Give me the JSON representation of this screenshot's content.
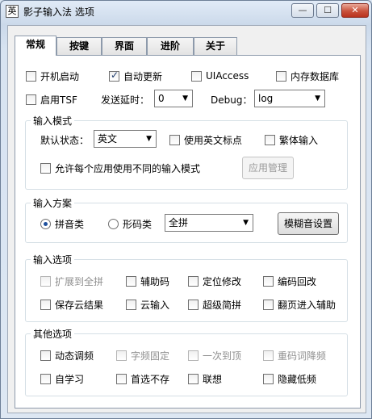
{
  "window": {
    "app_icon_char": "英",
    "title": "影子输入法 选项",
    "min_glyph": "—",
    "max_glyph": "☐",
    "close_glyph": "✕"
  },
  "tabs": [
    {
      "label": "常规"
    },
    {
      "label": "按键"
    },
    {
      "label": "界面"
    },
    {
      "label": "进阶"
    },
    {
      "label": "关于"
    }
  ],
  "general": {
    "autostart": {
      "label": "开机启动",
      "checked": false
    },
    "autoupdate": {
      "label": "自动更新",
      "checked": true
    },
    "uiaccess": {
      "label": "UIAccess",
      "checked": false
    },
    "memdb": {
      "label": "内存数据库",
      "checked": false
    },
    "tsf": {
      "label": "启用TSF",
      "checked": false
    },
    "delay_label": "发送延时：",
    "delay_value": "0",
    "debug_label": "Debug：",
    "debug_value": "log"
  },
  "input_mode": {
    "title": "输入模式",
    "default_state_label": "默认状态：",
    "default_state_value": "英文",
    "english_punct": {
      "label": "使用英文标点",
      "checked": false
    },
    "traditional": {
      "label": "繁体输入",
      "checked": false
    },
    "per_app": {
      "label": "允许每个应用使用不同的输入模式",
      "checked": false
    },
    "app_manage_button": "应用管理"
  },
  "input_scheme": {
    "title": "输入方案",
    "pinyin": {
      "label": "拼音类",
      "checked": true
    },
    "shape": {
      "label": "形码类",
      "checked": false
    },
    "scheme_value": "全拼",
    "fuzzy_button": "模糊音设置"
  },
  "input_options": {
    "title": "输入选项",
    "items": [
      {
        "label": "扩展到全拼",
        "checked": false,
        "disabled": true
      },
      {
        "label": "辅助码",
        "checked": false,
        "disabled": false
      },
      {
        "label": "定位修改",
        "checked": false,
        "disabled": false
      },
      {
        "label": "编码回改",
        "checked": false,
        "disabled": false
      },
      {
        "label": "保存云结果",
        "checked": false,
        "disabled": false
      },
      {
        "label": "云输入",
        "checked": false,
        "disabled": false
      },
      {
        "label": "超级简拼",
        "checked": false,
        "disabled": false
      },
      {
        "label": "翻页进入辅助",
        "checked": false,
        "disabled": false
      }
    ]
  },
  "other_options": {
    "title": "其他选项",
    "items": [
      {
        "label": "动态调频",
        "checked": false,
        "disabled": false
      },
      {
        "label": "字频固定",
        "checked": false,
        "disabled": true
      },
      {
        "label": "一次到顶",
        "checked": false,
        "disabled": true
      },
      {
        "label": "重码词降频",
        "checked": false,
        "disabled": true
      },
      {
        "label": "自学习",
        "checked": false,
        "disabled": false
      },
      {
        "label": "首选不存",
        "checked": false,
        "disabled": false
      },
      {
        "label": "联想",
        "checked": false,
        "disabled": false
      },
      {
        "label": "隐藏低频",
        "checked": false,
        "disabled": false
      }
    ]
  },
  "dropdown_arrow": "▼"
}
